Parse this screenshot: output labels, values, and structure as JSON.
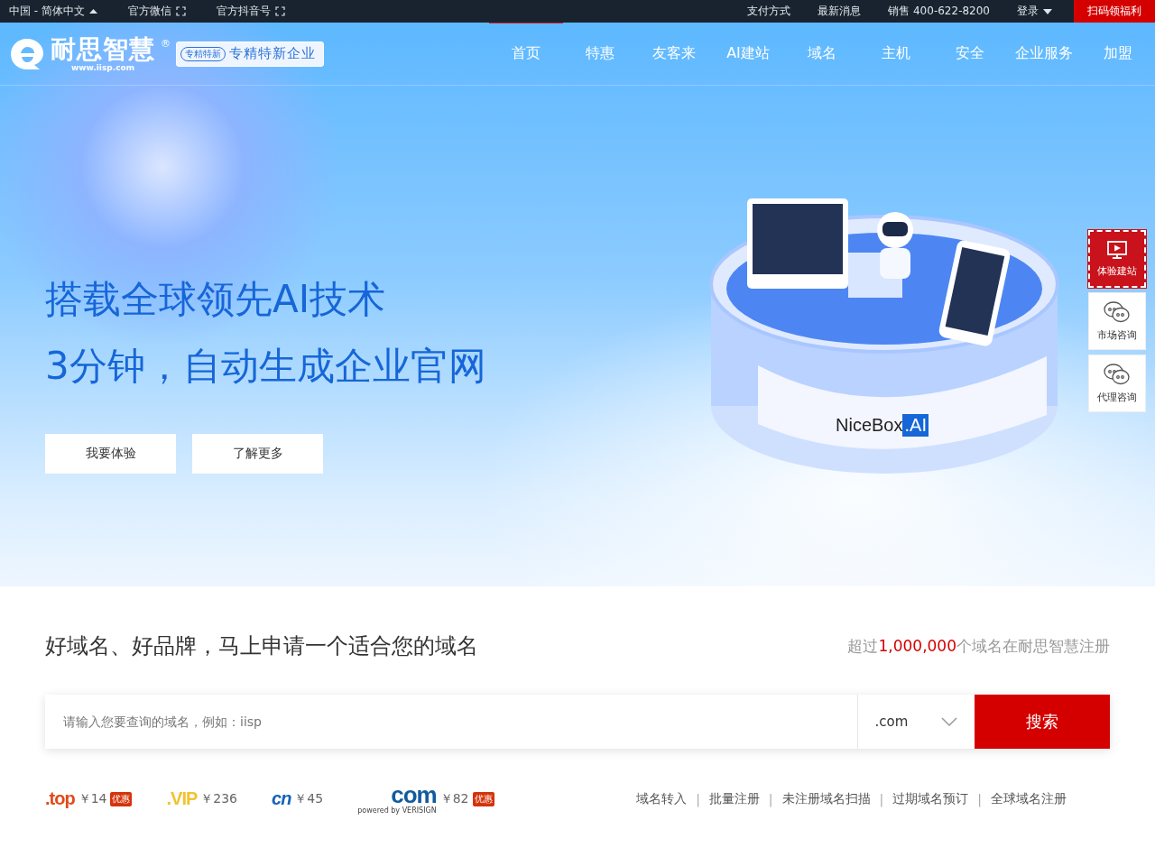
{
  "top_bar": {
    "left": [
      {
        "label": "中国 - 简体中文",
        "kind": "dropdown"
      },
      {
        "label": "官方微信",
        "kind": "qr"
      },
      {
        "label": "官方抖音号",
        "kind": "qr"
      }
    ],
    "right": [
      {
        "label": "支付方式",
        "kind": "link"
      },
      {
        "label": "最新消息",
        "kind": "link"
      },
      {
        "label": "销售 400-622-8200",
        "kind": "link"
      },
      {
        "label": "登录",
        "kind": "dropdown"
      }
    ],
    "promo": "扫码领福利"
  },
  "header": {
    "logo": {
      "name": "耐思智慧",
      "mark": "®",
      "url": "www.iisp.com"
    },
    "badge": {
      "seal": "专精特新",
      "label": "专精特新企业"
    },
    "nav": [
      {
        "label": "首页",
        "selected": true
      },
      {
        "label": "特惠",
        "selected": false
      },
      {
        "label": "友客来",
        "selected": false
      },
      {
        "label": "AI建站",
        "selected": false
      },
      {
        "label": "域名",
        "selected": false
      },
      {
        "label": "主机",
        "selected": false
      },
      {
        "label": "安全",
        "selected": false
      },
      {
        "label": "企业服务",
        "selected": false
      },
      {
        "label": "加盟",
        "selected": false
      }
    ]
  },
  "hero": {
    "headline": "搭载全球领先AI技术",
    "subline": "3分钟，自动生成企业官网",
    "buttons": [
      "我要体验",
      "了解更多"
    ],
    "product": {
      "name": "NiceBox",
      "suffix": ".AI"
    }
  },
  "side_dock": [
    {
      "label": "体验建站",
      "kind": "primary"
    },
    {
      "label": "市场咨询",
      "kind": "chat"
    },
    {
      "label": "代理咨询",
      "kind": "chat"
    }
  ],
  "domain": {
    "title": "好域名、好品牌，马上申请一个适合您的域名",
    "stat": {
      "before": "超过",
      "count": "1,000,000",
      "after": "个域名在耐思智慧注册"
    },
    "search": {
      "placeholder": "请输入您要查询的域名，例如：iisp",
      "suffix": ".com",
      "button": "搜索"
    },
    "prices": [
      {
        "kind": "top",
        "logo": ".top",
        "price": "￥14",
        "tag": "优惠"
      },
      {
        "kind": "vip",
        "logo": ".VIP",
        "price": "￥236"
      },
      {
        "kind": "cn",
        "logo": "cn",
        "price": "￥45"
      },
      {
        "kind": "com",
        "logo": "com",
        "sub": "powered by VERISIGN",
        "price": "￥82",
        "tag": "优惠"
      }
    ],
    "links": [
      {
        "label": "域名转入"
      },
      {
        "separator": "|",
        "label": "批量注册"
      },
      {
        "separator": "|",
        "label": "未注册域名扫描"
      },
      {
        "separator": "|",
        "label": "过期域名预订"
      },
      {
        "separator": "|",
        "label": "全球域名注册"
      }
    ]
  }
}
